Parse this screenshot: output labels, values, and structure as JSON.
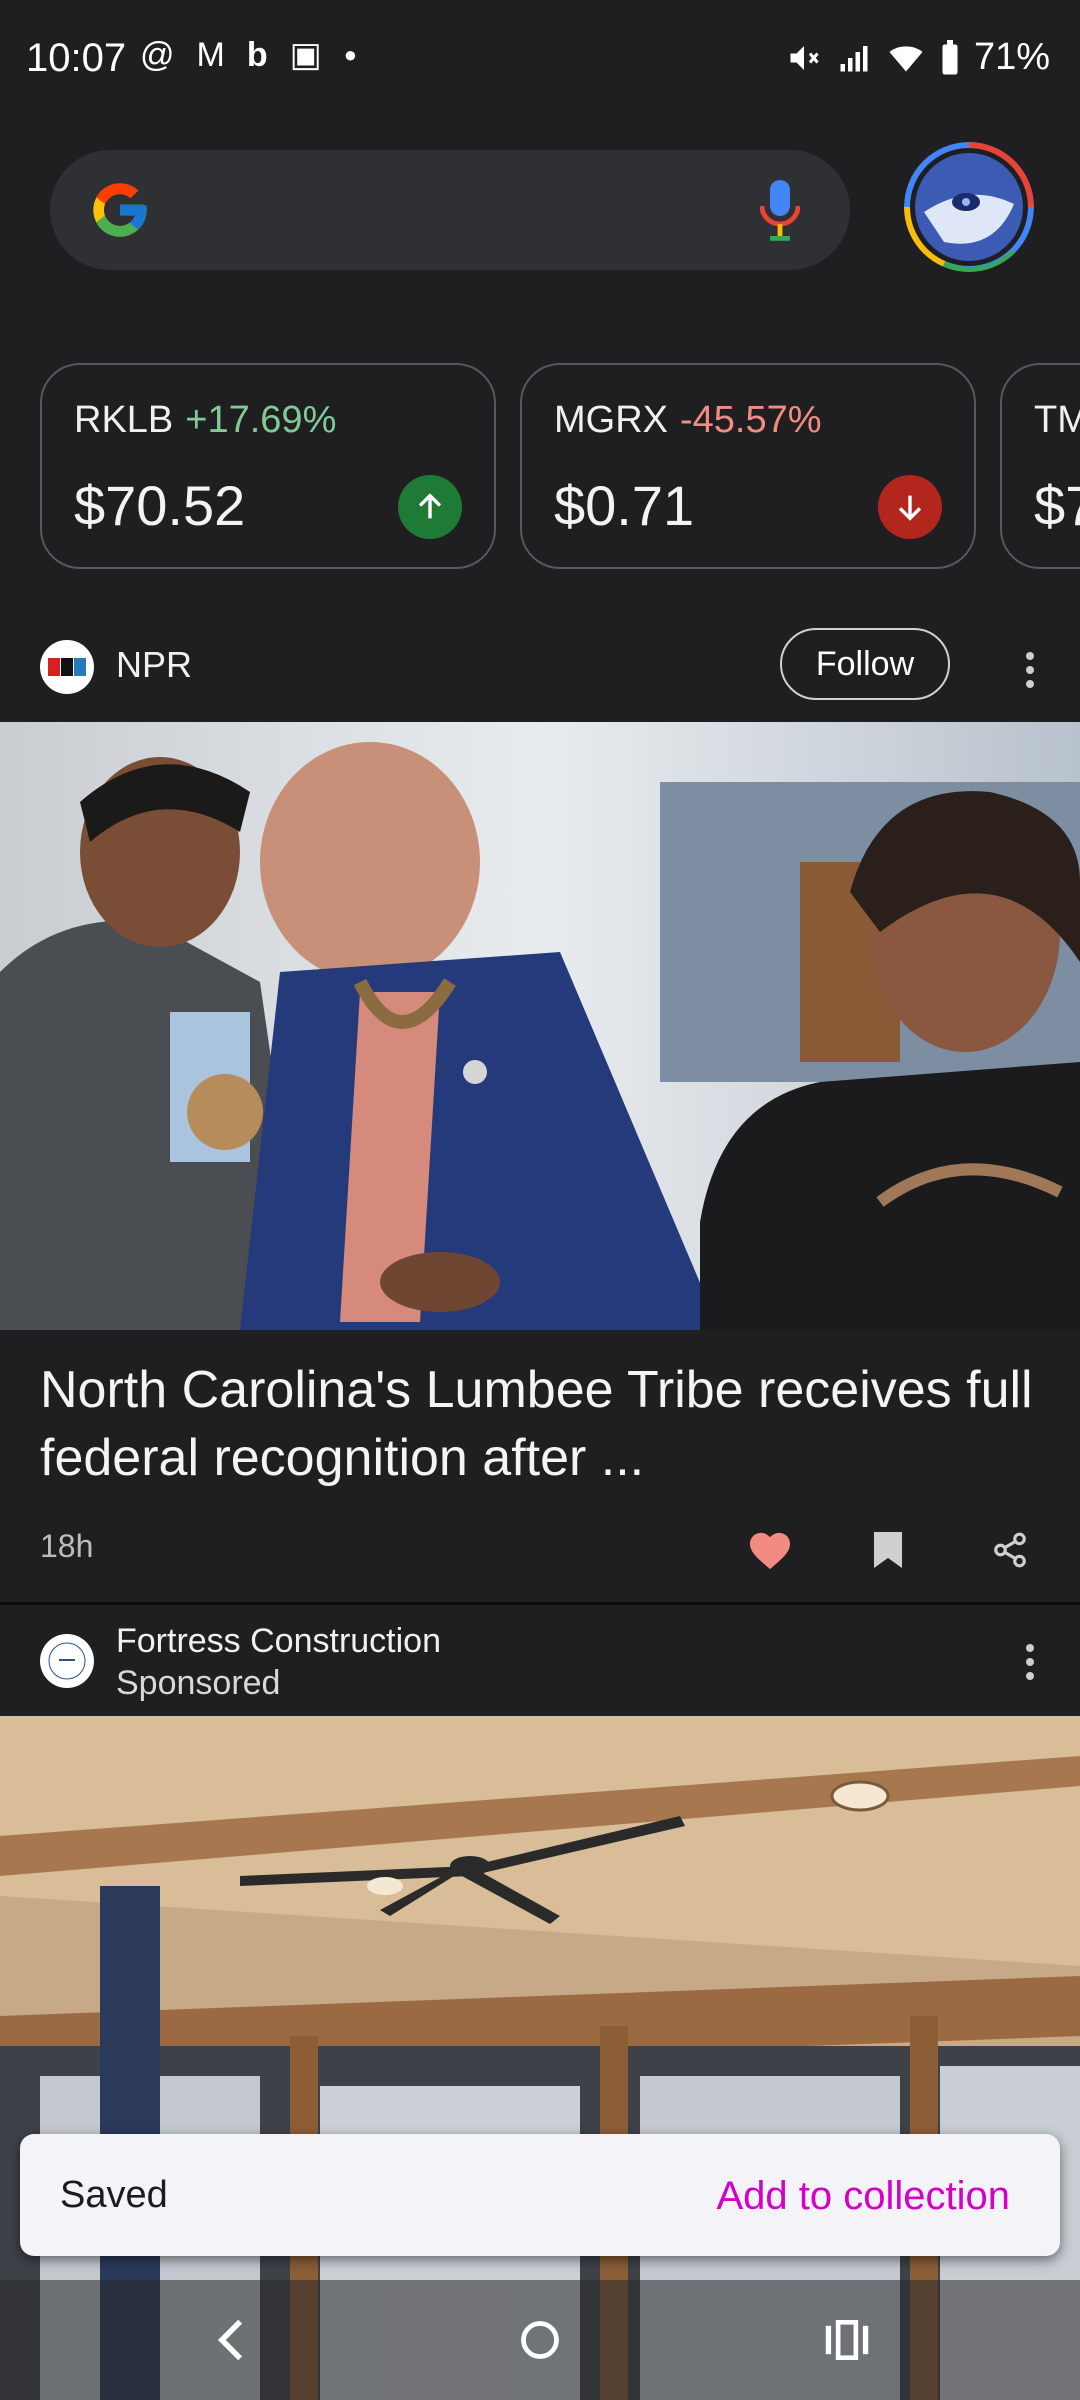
{
  "status_bar": {
    "time": "10:07",
    "left_icons": [
      "threads-icon",
      "gmail-icon",
      "bing-icon",
      "phone-app-icon",
      "dot-icon"
    ],
    "battery": "71%"
  },
  "search": {
    "placeholder": ""
  },
  "stocks": [
    {
      "symbol": "RKLB",
      "change": "+17.69%",
      "price": "$70.52",
      "direction": "up",
      "color": "#81c995"
    },
    {
      "symbol": "MGRX",
      "change": "-45.57%",
      "price": "$0.71",
      "direction": "down",
      "color": "#f28b82"
    },
    {
      "symbol": "TM",
      "change": "",
      "price": "$7",
      "direction": "",
      "color": ""
    }
  ],
  "article": {
    "publisher": "NPR",
    "follow_label": "Follow",
    "headline": "North Carolina's Lumbee Tribe receives full federal recognition after ...",
    "time_ago": "18h"
  },
  "sponsored": {
    "advertiser": "Fortress Construction",
    "label": "Sponsored"
  },
  "snackbar": {
    "message": "Saved",
    "action": "Add to collection"
  },
  "colors": {
    "up": "#1e7a34",
    "down": "#b3261e",
    "heart": "#f28b82",
    "accent": "#d400c8"
  }
}
